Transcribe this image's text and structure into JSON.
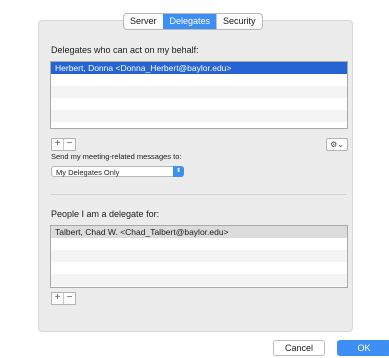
{
  "tabs": [
    "Server",
    "Delegates",
    "Security"
  ],
  "delegates": {
    "heading": "Delegates who can act on my behalf:",
    "rows": [
      "Herbert, Donna <Donna_Herbert@baylor.edu>",
      "",
      "",
      "",
      "",
      ""
    ],
    "add_label": "+",
    "remove_label": "−",
    "gear_label": "⚙⌄"
  },
  "meeting": {
    "label": "Send my meeting-related messages to:",
    "selected": "My Delegates Only",
    "arrow": "⬍"
  },
  "delegate_for": {
    "heading": "People I am a delegate for:",
    "rows": [
      "Talbert, Chad W. <Chad_Talbert@baylor.edu>",
      "",
      "",
      "",
      "",
      ""
    ],
    "add_label": "+",
    "remove_label": "−"
  },
  "footer": {
    "cancel_label": "Cancel",
    "ok_label": "OK"
  }
}
